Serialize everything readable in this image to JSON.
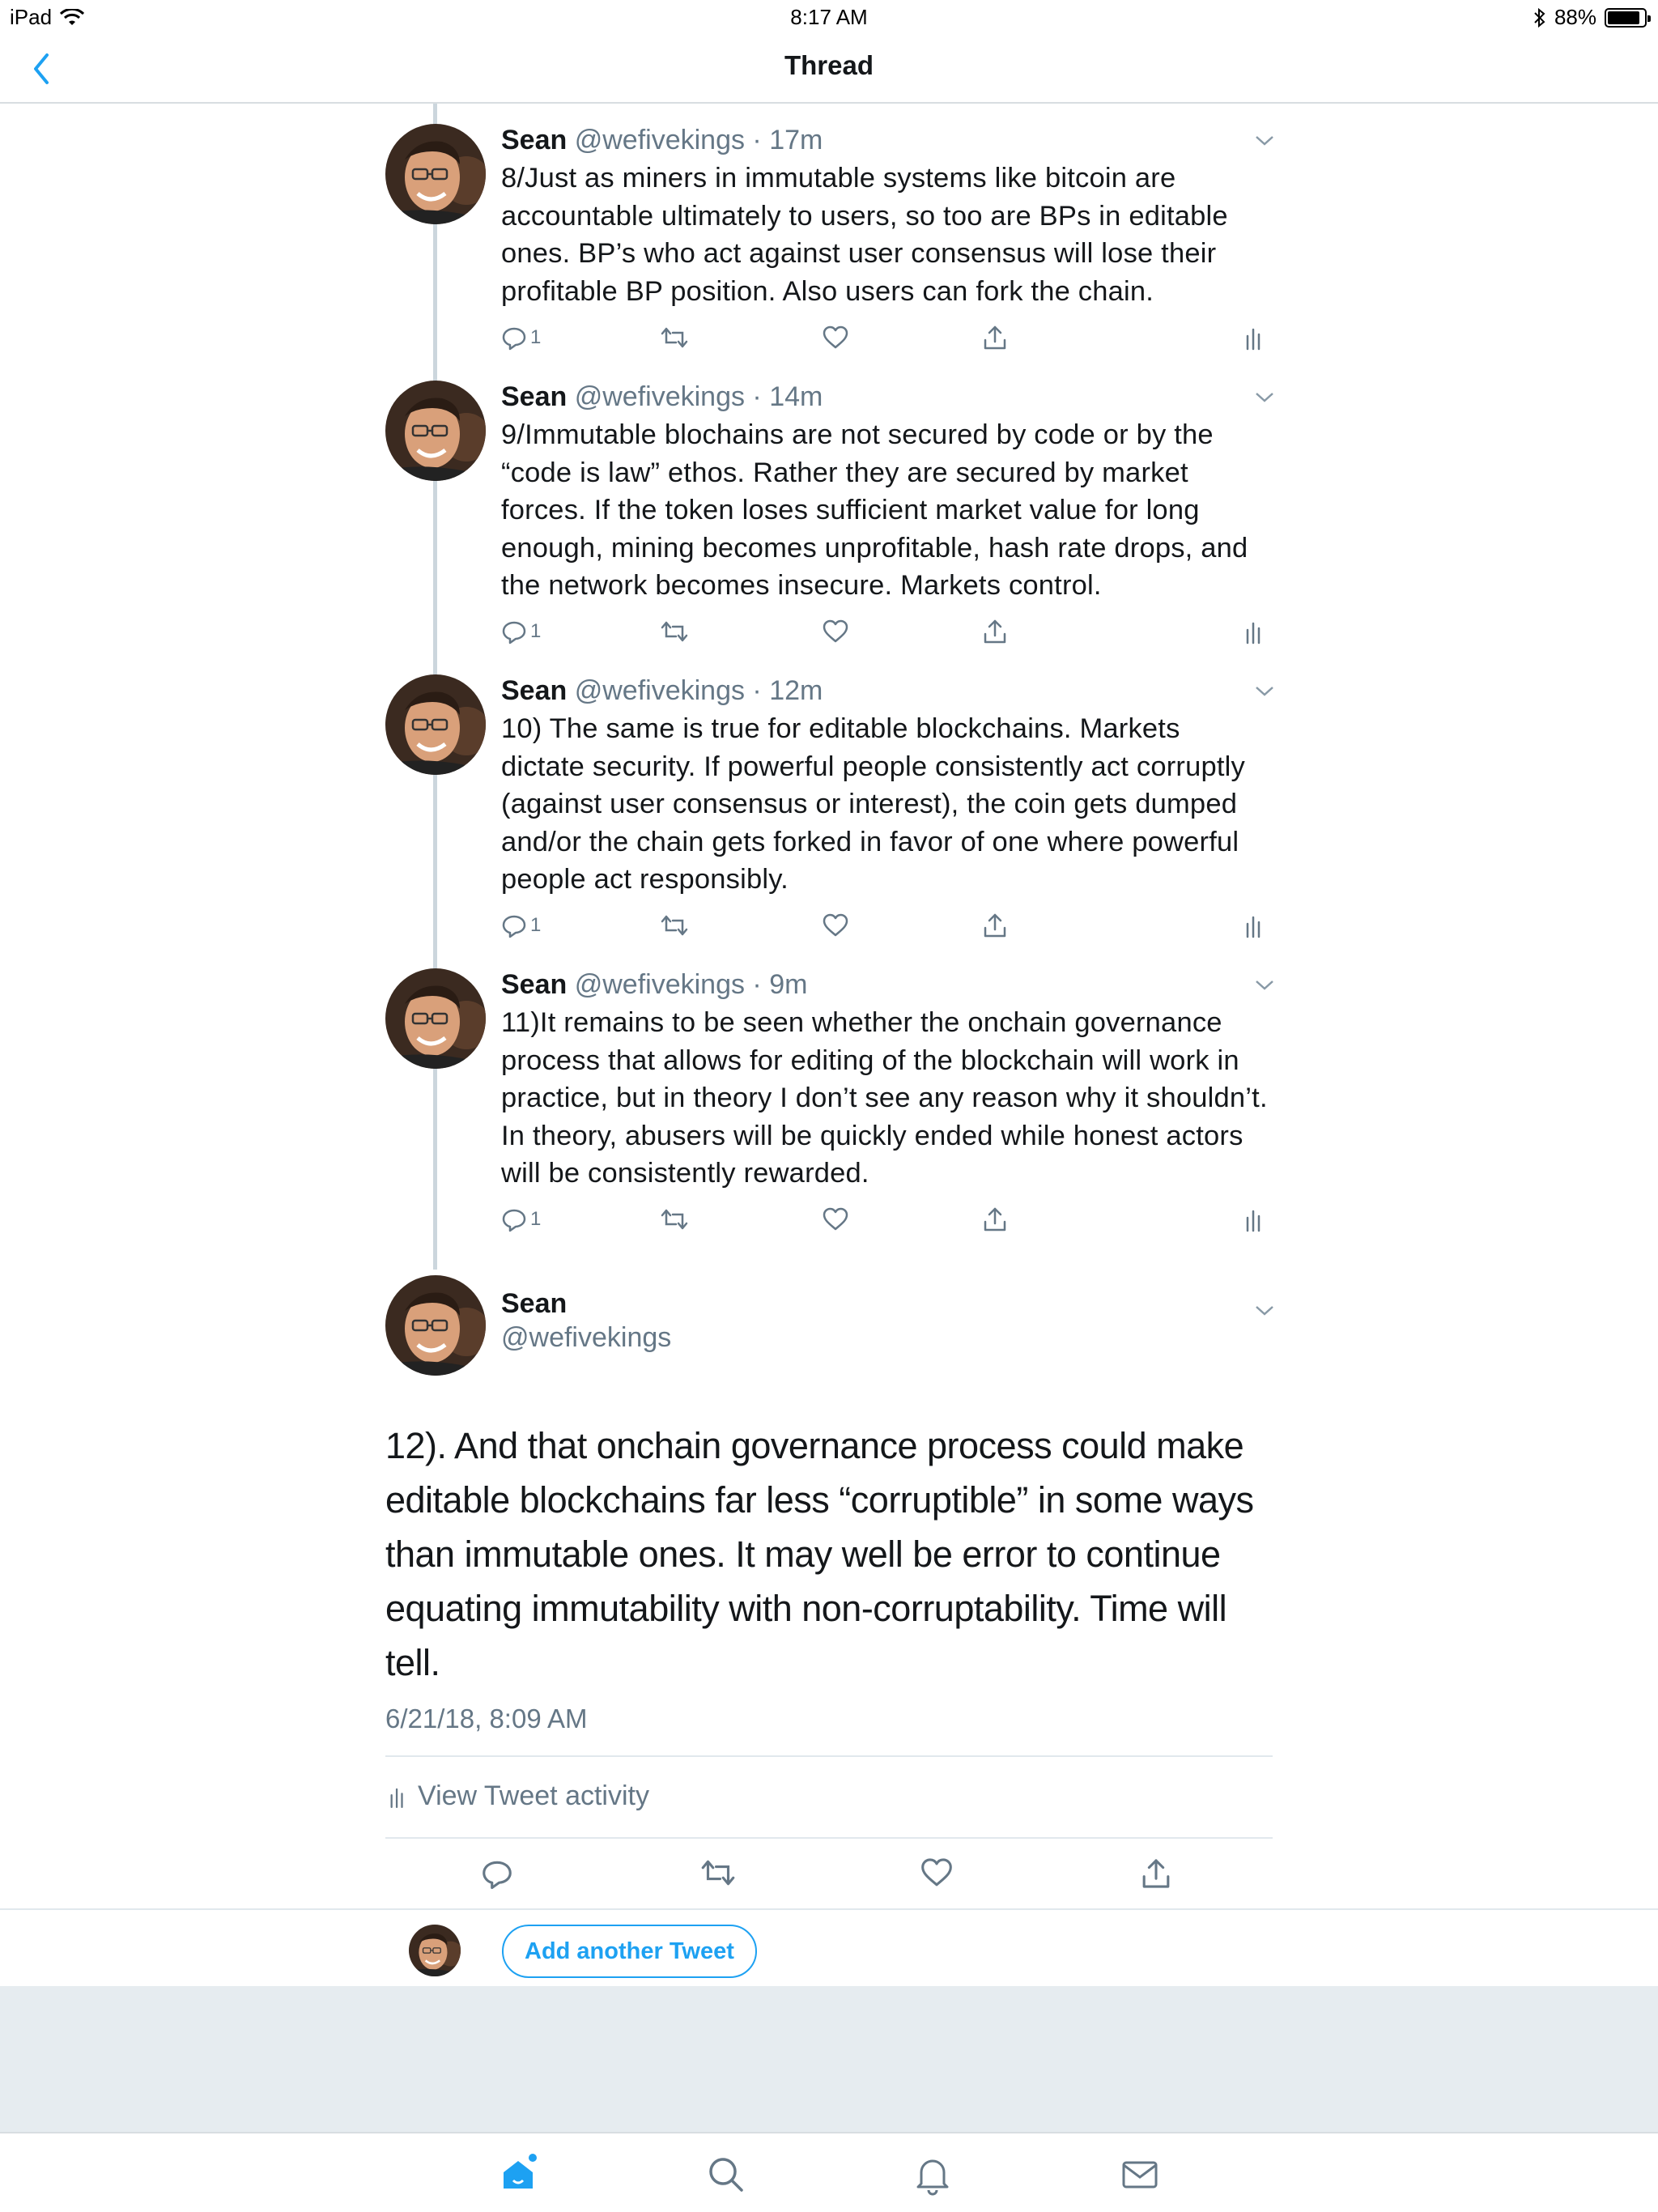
{
  "status_bar": {
    "device": "iPad",
    "time": "8:17 AM",
    "battery": "88%",
    "battery_level": 0.88
  },
  "nav": {
    "title": "Thread"
  },
  "tweets": [
    {
      "name": "Sean",
      "meta": "@wefivekings · 17m",
      "text": "8/Just as miners in immutable systems like bitcoin are accountable ultimately to users, so too are BPs in editable ones. BP’s who act against user consensus will lose their profitable BP position.  Also users can fork the chain.",
      "reply_count": "1"
    },
    {
      "name": "Sean",
      "meta": "@wefivekings · 14m",
      "text": "9/Immutable blochains are not secured by code or by the “code is law” ethos.  Rather they are secured by market forces.    If the token loses sufficient market value for long enough, mining becomes unprofitable, hash rate drops, and the network becomes insecure.  Markets control.",
      "reply_count": "1"
    },
    {
      "name": "Sean",
      "meta": "@wefivekings · 12m",
      "text": "10) The same is true for editable blockchains.  Markets dictate security.  If powerful people consistently act corruptly (against user consensus or interest), the coin gets dumped and/or the chain gets forked in favor of one where powerful people act responsibly.",
      "reply_count": "1"
    },
    {
      "name": "Sean",
      "meta": "@wefivekings · 9m",
      "text": "11)It remains to be seen whether the onchain governance process that allows for editing of the blockchain will work in practice, but in theory I don’t see any reason why it shouldn’t.   In theory, abusers will be quickly ended while honest actors will be consistently rewarded.",
      "reply_count": "1"
    }
  ],
  "main_tweet": {
    "name": "Sean",
    "handle": "@wefivekings",
    "text": "12). And that onchain governance process could make editable blockchains far less “corruptible” in some ways than immutable ones.   It may well be error to continue equating immutability with non-corruptability.  Time will tell.",
    "timestamp": "6/21/18, 8:09 AM",
    "activity_label": "View Tweet activity"
  },
  "reply_bar": {
    "button_label": "Add another Tweet"
  },
  "tabs": [
    "home-icon",
    "search-icon",
    "notifications-icon",
    "messages-icon"
  ],
  "colors": {
    "accent": "#1da1f2",
    "secondary_text": "#657786",
    "thread_line": "#ccd6dd"
  }
}
